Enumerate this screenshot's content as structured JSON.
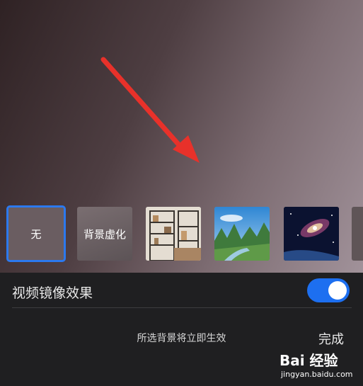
{
  "background_options": [
    {
      "id": "none",
      "label": "无",
      "selected": true
    },
    {
      "id": "blur",
      "label": "背景虚化",
      "selected": false
    },
    {
      "id": "office",
      "label": "",
      "selected": false
    },
    {
      "id": "landscape",
      "label": "",
      "selected": false
    },
    {
      "id": "space",
      "label": "",
      "selected": false
    }
  ],
  "mirror": {
    "label": "视频镜像效果",
    "enabled": true
  },
  "hint": "所选背景将立即生效",
  "done_label": "完成",
  "watermark": {
    "main": "Bai 经验",
    "sub": "jingyan.baidu.com"
  },
  "colors": {
    "accent": "#2c79ee",
    "toggle_on": "#1d6ff0",
    "arrow": "#e8312a",
    "panel": "#1f1f21"
  },
  "icons": {
    "annotation": "red-arrow-icon",
    "watermark": "baidu-paw-icon"
  }
}
